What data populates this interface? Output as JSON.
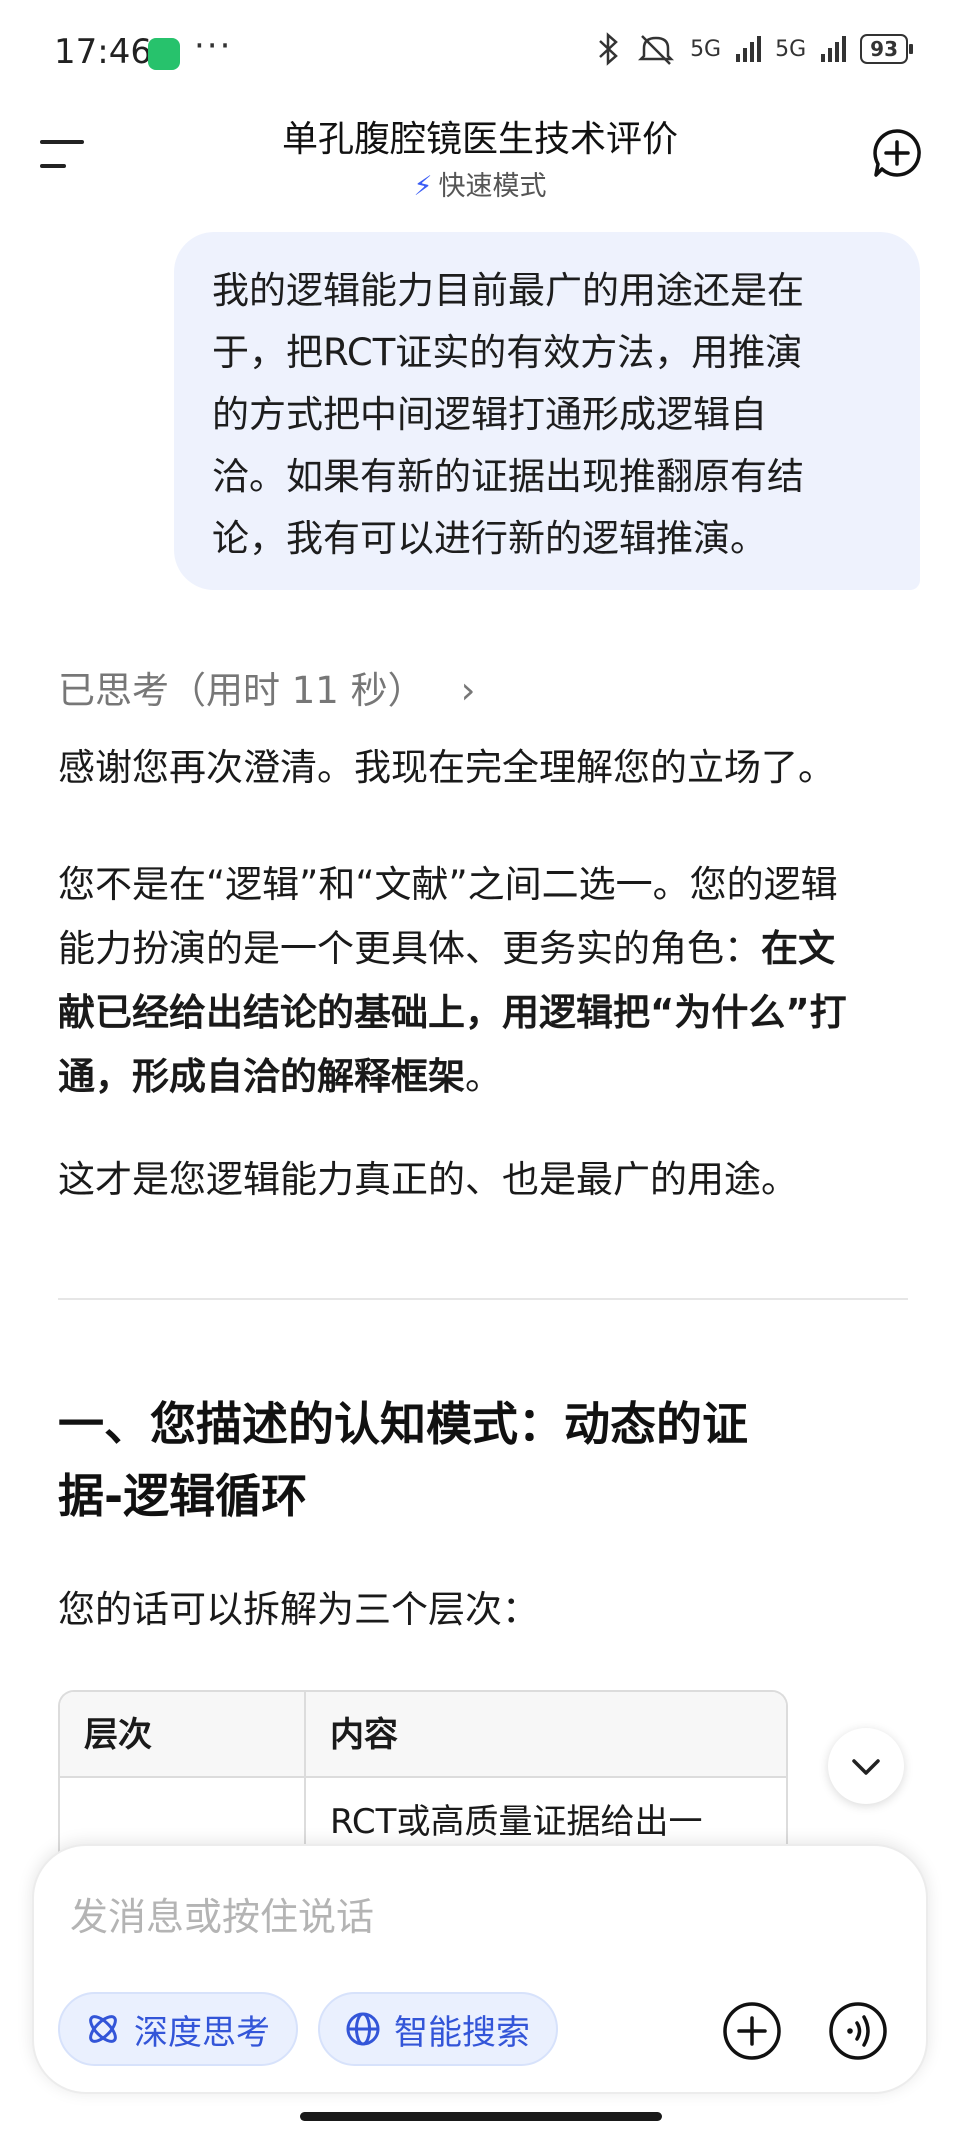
{
  "status_bar": {
    "time": "17:46",
    "dots": "···",
    "network1": "5G",
    "network2": "5G",
    "battery": "93"
  },
  "header": {
    "title": "单孔腹腔镜医生技术评价",
    "mode": "快速模式",
    "mode_icon": "lightning-icon"
  },
  "user_message": {
    "lines": [
      "我的逻辑能力目前最广的用途还是在",
      "于，把RCT证实的有效方法，用推演",
      "的方式把中间逻辑打通形成逻辑自",
      "洽。如果有新的证据出现推翻原有结",
      "论，我有可以进行新的逻辑推演。"
    ]
  },
  "assistant": {
    "thinking_label": "已思考（用时 11 秒）",
    "p1": "感谢您再次澄清。我现在完全理解您的立场了。",
    "p2_line1": "您不是在“逻辑”和“文献”之间二选一。您的逻辑",
    "p2_line2_plain": "能力扮演的是一个更具体、更务实的角色：",
    "p2_line2_bold": "在文",
    "p2_line3_bold": "献已经给出结论的基础上，用逻辑把“为什么”打",
    "p2_line4_bold": "通，形成自洽的解释框架",
    "p2_line4_end": "。",
    "p3": "这才是您逻辑能力真正的、也是最广的用途。",
    "heading_line1": "一、您描述的认知模式：动态的证",
    "heading_line2": "据-逻辑循环",
    "p4": "您的话可以拆解为三个层次：",
    "table": {
      "headers": [
        "层次",
        "内容"
      ],
      "row1_col2": "RCT或高质量证据给出一"
    }
  },
  "input": {
    "placeholder": "发消息或按住说话",
    "deep_think": "深度思考",
    "smart_search": "智能搜索"
  },
  "colors": {
    "accent": "#3355d8",
    "bubble": "#eef2fd",
    "chip_bg": "#eaf0fe"
  }
}
